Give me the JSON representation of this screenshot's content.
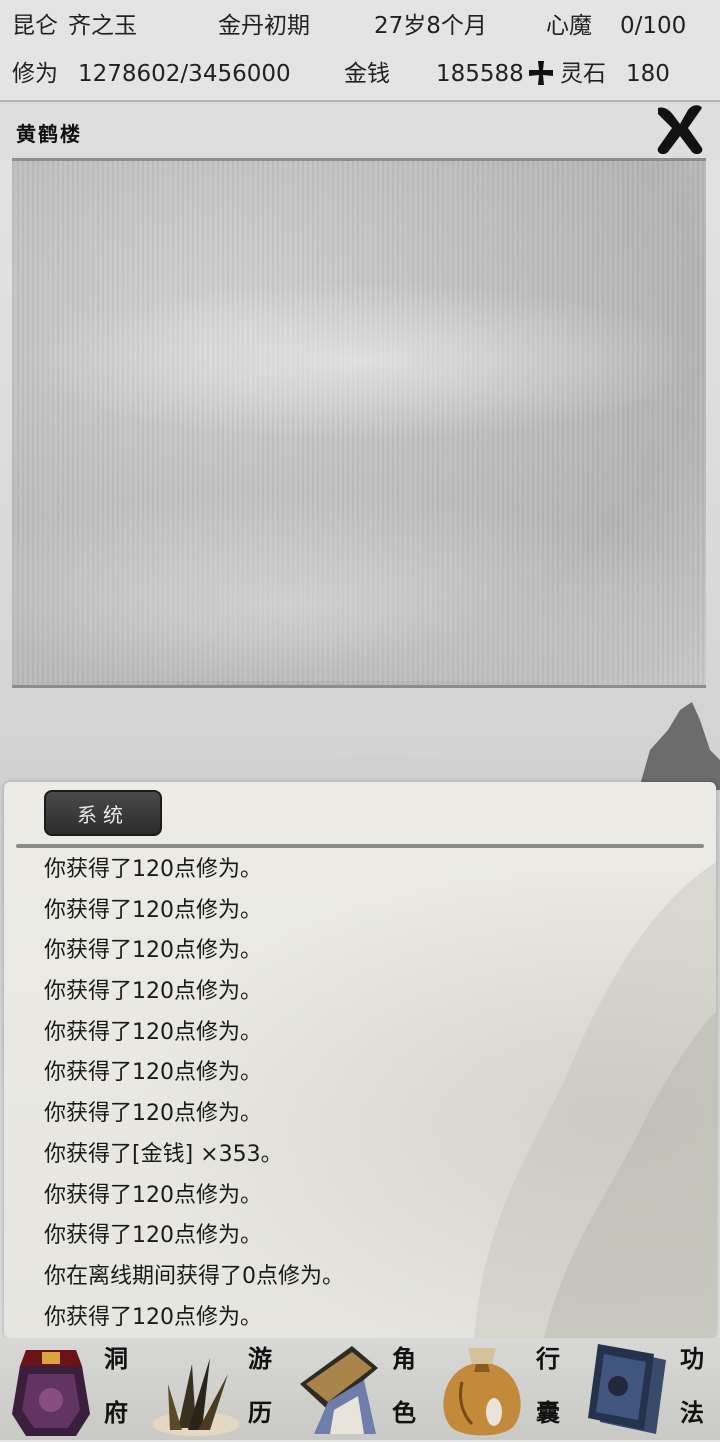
{
  "status": {
    "sect": "昆仑",
    "name": "齐之玉",
    "realm": "金丹初期",
    "age": "27岁8个月",
    "heart_demon_label": "心魔",
    "heart_demon_value": "0/100",
    "cultivation_label": "修为",
    "cultivation_value": "1278602/3456000",
    "money_label": "金钱",
    "money_value": "185588",
    "spirit_stone_label": "灵石",
    "spirit_stone_value": "180"
  },
  "location": {
    "title": "黄鹤楼"
  },
  "log": {
    "tab_label": "系统",
    "lines": [
      "你获得了120点修为。",
      "你获得了120点修为。",
      "你获得了120点修为。",
      "你获得了120点修为。",
      "你获得了120点修为。",
      "你获得了120点修为。",
      "你获得了120点修为。",
      "你获得了[金钱] ×353。",
      "你获得了120点修为。",
      "你获得了120点修为。",
      "你在离线期间获得了0点修为。",
      "你获得了120点修为。"
    ]
  },
  "nav": {
    "items": [
      {
        "label_top": "洞",
        "label_bottom": "府",
        "icon": "cave-dwelling-icon"
      },
      {
        "label_top": "游",
        "label_bottom": "历",
        "icon": "travel-icon"
      },
      {
        "label_top": "角",
        "label_bottom": "色",
        "icon": "character-icon"
      },
      {
        "label_top": "行",
        "label_bottom": "囊",
        "icon": "inventory-bag-icon"
      },
      {
        "label_top": "功",
        "label_bottom": "法",
        "icon": "skill-book-icon"
      }
    ]
  }
}
